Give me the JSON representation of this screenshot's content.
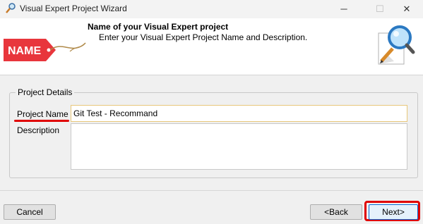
{
  "window": {
    "title": "Visual Expert Project Wizard",
    "minimize_glyph": "─",
    "maximize_glyph": "☐",
    "close_glyph": "✕",
    "icon": "pencil-magnifier-icon"
  },
  "header": {
    "title": "Name of your Visual Expert project",
    "subtitle": "Enter your Visual Expert Project Name and Description.",
    "tag_text": "NAME",
    "tag_color": "#e8363c",
    "wizard_icon": "magnifier-pencil-icon"
  },
  "group": {
    "legend": "Project Details",
    "project_name_label": "Project Name",
    "project_name_value": "Git Test - Recommand",
    "description_label": "Description",
    "description_value": ""
  },
  "buttons": {
    "cancel": "Cancel",
    "back": "<Back",
    "next": "Next>"
  },
  "colors": {
    "highlight": "#e00000",
    "focus_border": "#e8c77a",
    "default_button_border": "#0a6cd6"
  }
}
